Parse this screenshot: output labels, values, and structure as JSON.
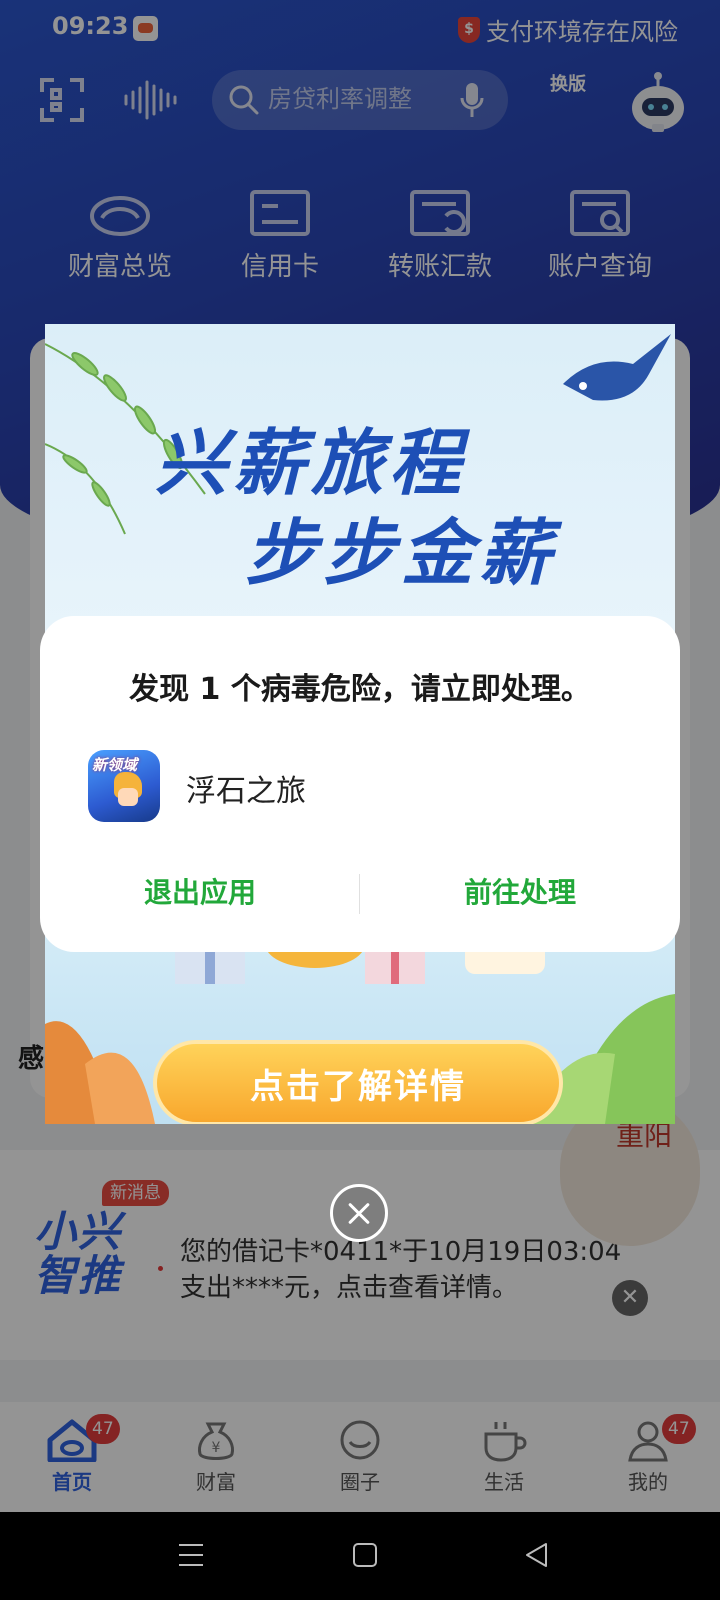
{
  "status_bar": {
    "time": "09:23",
    "risk_text": "支付环境存在风险",
    "shield_symbol": "$"
  },
  "header": {
    "search_placeholder": "房贷利率调整",
    "switch_version_label": "换版",
    "icons": [
      "scan-icon",
      "voice-wave-icon",
      "search-icon",
      "mic-icon",
      "switch-version-icon",
      "robot-assistant-icon"
    ]
  },
  "quick_actions": [
    {
      "label": "财富总览",
      "icon": "wealth-overview-icon"
    },
    {
      "label": "信用卡",
      "icon": "credit-card-icon"
    },
    {
      "label": "转账汇款",
      "icon": "transfer-icon"
    },
    {
      "label": "账户查询",
      "icon": "account-query-icon"
    }
  ],
  "page_section": {
    "feel_label": "感"
  },
  "promo": {
    "title_line1": "兴薪旅程",
    "title_line2": "步步金薪",
    "button_label": "点击了解详情"
  },
  "virus_dialog": {
    "title": "发现 1 个病毒危险，请立即处理。",
    "app_name": "浮石之旅",
    "app_icon_text": "新领域",
    "exit_label": "退出应用",
    "handle_label": "前往处理",
    "button_color": "#22a83a"
  },
  "notice": {
    "brand_line1": "小兴",
    "brand_line2": "智推",
    "badge": "新消息",
    "message": "您的借记卡*0411*于10月19日03:04支出****元，点击查看详情。"
  },
  "float_widget": {
    "text": "重阳"
  },
  "tabbar": {
    "tabs": [
      {
        "label": "首页",
        "badge": "47",
        "active": true
      },
      {
        "label": "财富"
      },
      {
        "label": "圈子"
      },
      {
        "label": "生活"
      },
      {
        "label": "我的",
        "badge": "47"
      }
    ],
    "accent_color": "#2f62e0",
    "badge_color": "#e33d3d"
  }
}
